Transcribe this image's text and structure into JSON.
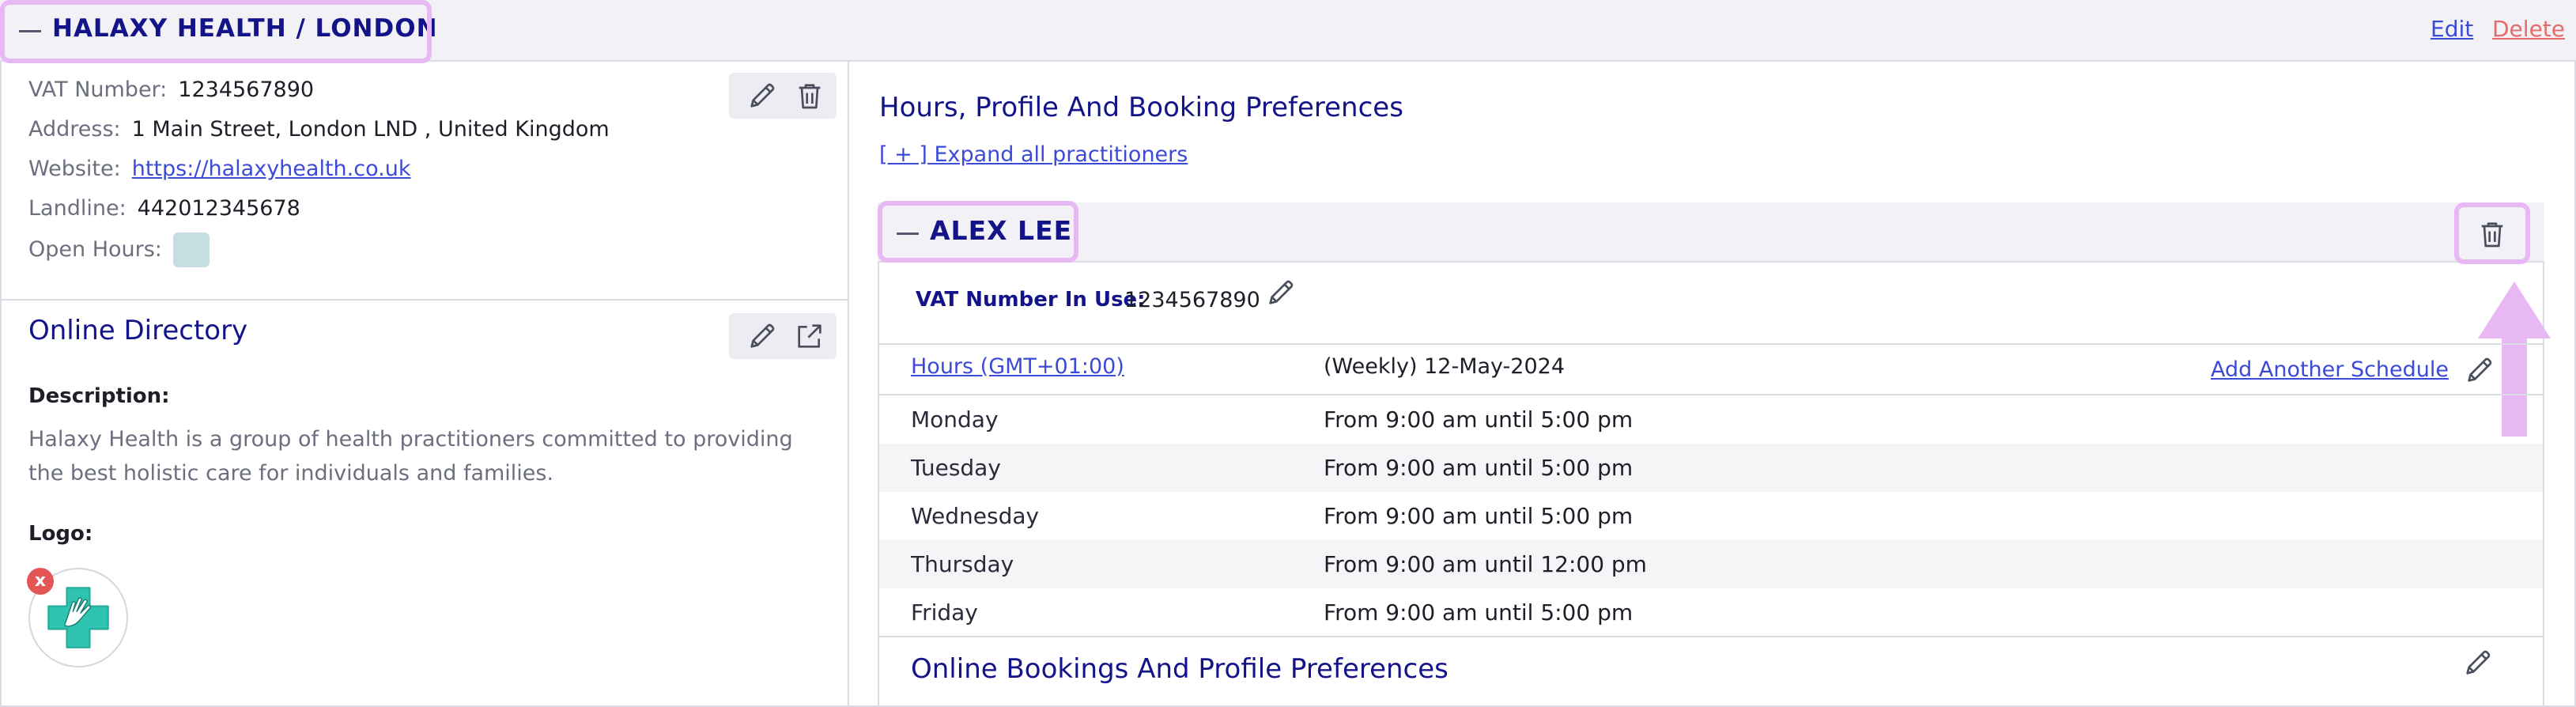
{
  "header": {
    "title": "HALAXY HEALTH / LONDON",
    "edit_label": "Edit",
    "delete_label": "Delete"
  },
  "org_info": {
    "vat_label": "VAT Number:",
    "vat_value": "1234567890",
    "address_label": "Address:",
    "address_value": "1 Main Street, London LND , United Kingdom",
    "website_label": "Website:",
    "website_value": "https://halaxyhealth.co.uk",
    "landline_label": "Landline:",
    "landline_value": "442012345678",
    "open_hours_label": "Open Hours:",
    "open_hours_swatch_color": "#c6dde1"
  },
  "directory": {
    "title": "Online Directory",
    "description_label": "Description:",
    "description": "Halaxy Health is a group of health practitioners committed to providing the best holistic care for individuals and families.",
    "logo_label": "Logo:",
    "logo_remove": "x"
  },
  "preferences": {
    "title": "Hours, Profile And Booking Preferences",
    "expand_link": "[ + ] Expand all practitioners"
  },
  "practitioner": {
    "name": "ALEX LEE",
    "vat_in_use_label": "VAT Number In Use:",
    "vat_in_use_value": "1234567890",
    "hours_link": "Hours (GMT+01:00)",
    "schedule_label": "(Weekly) 12-May-2024",
    "add_schedule": "Add Another Schedule",
    "schedule": [
      {
        "day": "Monday",
        "hours": "From 9:00 am until 5:00 pm"
      },
      {
        "day": "Tuesday",
        "hours": "From 9:00 am until 5:00 pm"
      },
      {
        "day": "Wednesday",
        "hours": "From 9:00 am until 5:00 pm"
      },
      {
        "day": "Thursday",
        "hours": "From 9:00 am until 12:00 pm"
      },
      {
        "day": "Friday",
        "hours": "From 9:00 am until 5:00 pm"
      }
    ],
    "bookings_title": "Online Bookings And Profile Preferences"
  },
  "colors": {
    "accent_navy": "#14148a",
    "link_blue": "#3c4ad8",
    "delete_red": "#e86a6a",
    "highlight": "#e8b8f4",
    "logo_teal": "#2ec4b0"
  },
  "icons": [
    "minus-icon",
    "pencil-icon",
    "trash-icon",
    "external-link-icon",
    "logo-cross-hand-icon",
    "arrow-up-icon"
  ]
}
